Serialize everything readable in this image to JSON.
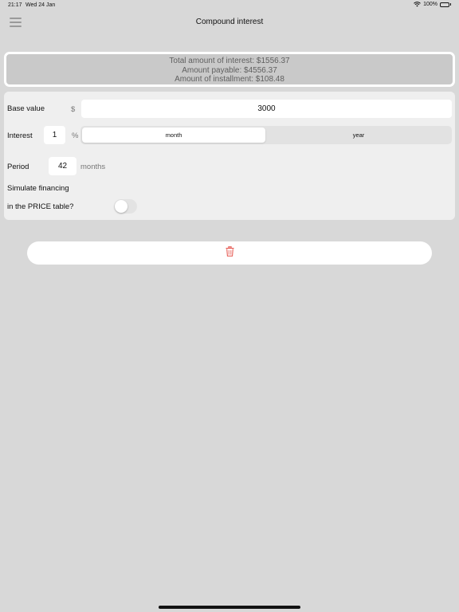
{
  "status_bar": {
    "time": "21:17",
    "date": "Wed 24 Jan",
    "battery": "100%"
  },
  "nav": {
    "title": "Compound interest",
    "menu_icon": "hamburger-menu-icon"
  },
  "summary": {
    "total_interest": "Total amount of interest: $1556.37",
    "amount_payable": "Amount payable: $4556.37",
    "installment": "Amount of installment: $108.48"
  },
  "form": {
    "base_value": {
      "label": "Base value",
      "currency": "$",
      "value": "3000"
    },
    "interest": {
      "label": "Interest",
      "value": "1",
      "unit": "%",
      "options": [
        "month",
        "year"
      ],
      "selected": "month"
    },
    "period": {
      "label": "Period",
      "value": "42",
      "unit": "months"
    },
    "simulate": {
      "label_line1": "Simulate financing",
      "label_line2": "in the PRICE table?",
      "enabled": false
    }
  },
  "actions": {
    "delete_icon": "trash-icon",
    "delete_color": "#e5534b"
  },
  "colors": {
    "background": "#d8d8d8",
    "card": "#efefef",
    "summary_bg": "#c9c9c9",
    "summary_text": "#5f5f5f"
  }
}
